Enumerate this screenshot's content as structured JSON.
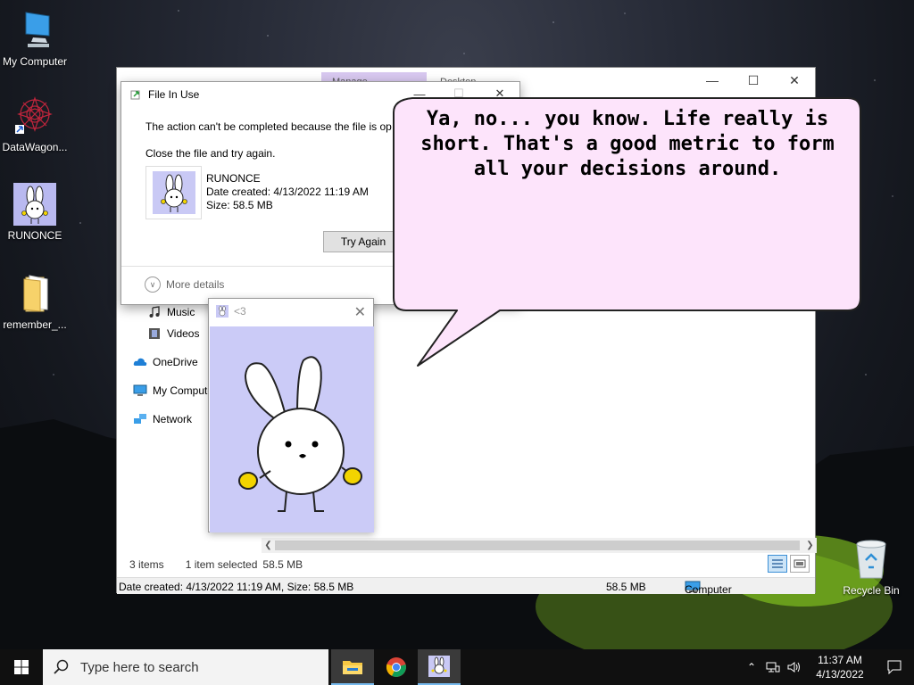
{
  "desktop": {
    "icons": [
      {
        "label": "My Computer",
        "icon": "monitor-icon"
      },
      {
        "label": "DataWagon...",
        "icon": "mandala-shortcut-icon"
      },
      {
        "label": "RUNONCE",
        "icon": "bunny-icon"
      },
      {
        "label": "remember_...",
        "icon": "folder-icon"
      }
    ],
    "recycle_bin": "Recycle Bin"
  },
  "explorer": {
    "tabs": {
      "manage": "Manage",
      "desktop": "Desktop"
    },
    "nav": [
      {
        "label": "Music",
        "icon": "music-note-icon"
      },
      {
        "label": "Videos",
        "icon": "film-icon"
      },
      {
        "label": "OneDrive",
        "icon": "cloud-icon"
      },
      {
        "label": "My Computer",
        "icon": "monitor-icon"
      },
      {
        "label": "Network",
        "icon": "network-icon"
      }
    ],
    "status": {
      "items": "3 items",
      "selected": "1 item selected",
      "size": "58.5 MB"
    },
    "details_bar": {
      "info": "Date created: 4/13/2022 11:19 AM, Size: 58.5 MB",
      "size": "58.5 MB",
      "location": "Computer"
    }
  },
  "dialog": {
    "title": "File In Use",
    "message": "The action can't be completed because the file is op",
    "instruction": "Close the file and try again.",
    "file": {
      "name": "RUNONCE",
      "created": "Date created: 4/13/2022 11:19 AM",
      "size": "Size: 58.5 MB"
    },
    "try_again": "Try Again",
    "more_details": "More details"
  },
  "viewer": {
    "title": "<3"
  },
  "bubble": {
    "text": "Ya, no... you know. Life really is short. That's a good metric to form all your decisions around."
  },
  "taskbar": {
    "search_placeholder": "Type here to search",
    "time": "11:37 AM",
    "date": "4/13/2022"
  },
  "colors": {
    "accent": "#0078d7",
    "bubble_fill": "#fde4fb",
    "manage_tab": "#d8c8f0",
    "bunny_bg": "#cbcbf7"
  }
}
